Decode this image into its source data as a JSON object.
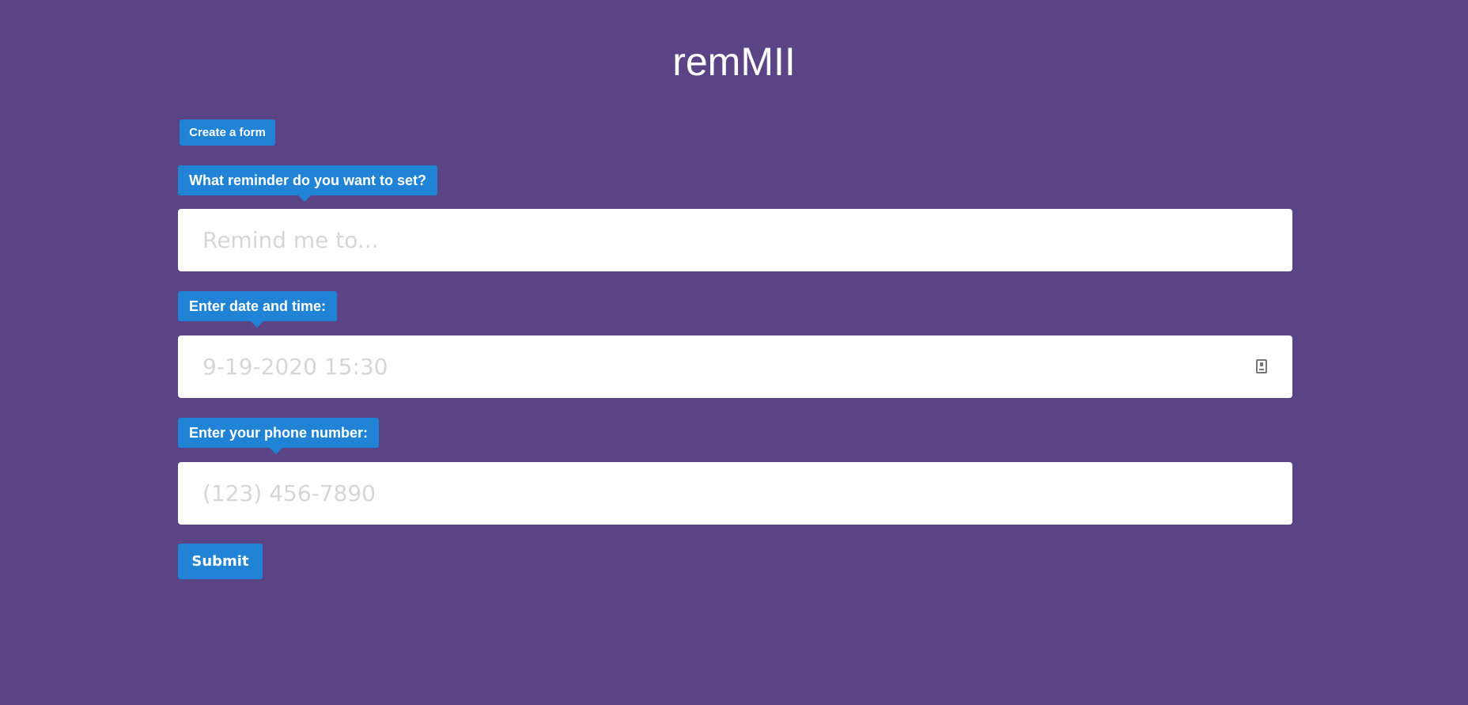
{
  "app": {
    "title": "remMII"
  },
  "header": {
    "create_form_label": "Create a form"
  },
  "form": {
    "reminder": {
      "label": "What reminder do you want to set?",
      "placeholder": "Remind me to...",
      "value": ""
    },
    "datetime": {
      "label": "Enter date and time:",
      "placeholder": "9-19-2020 15:30",
      "value": "",
      "icon": "calendar-icon"
    },
    "phone": {
      "label": "Enter your phone number:",
      "placeholder": "(123) 456-7890",
      "value": ""
    },
    "submit_label": "Submit"
  },
  "colors": {
    "background": "#5a4486",
    "accent": "#2183d6",
    "field_background": "#ffffff",
    "placeholder_text": "#d6d6d6"
  }
}
